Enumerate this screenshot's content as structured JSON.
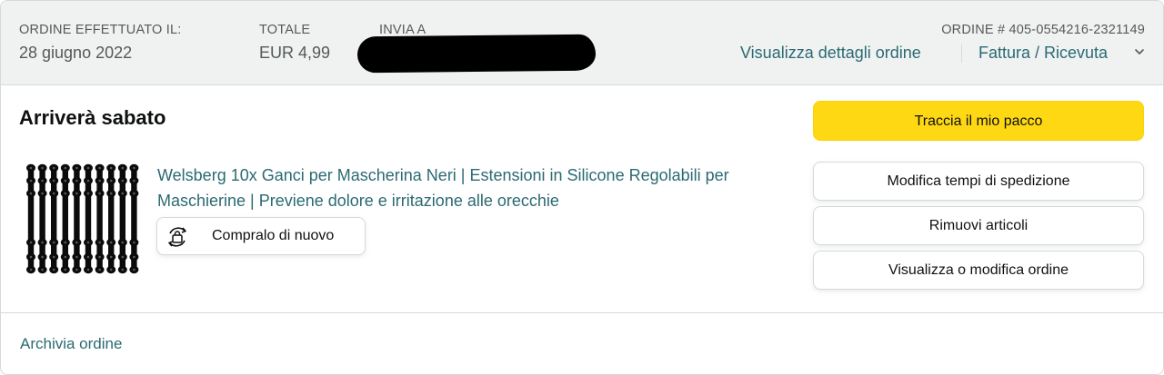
{
  "header": {
    "order_placed_label": "ORDINE EFFETTUATO IL:",
    "order_placed_value": "28 giugno 2022",
    "total_label": "TOTALE",
    "total_value": "EUR 4,99",
    "ship_to_label": "INVIA A",
    "order_number": "ORDINE # 405-0554216-2321149",
    "view_details_link": "Visualizza dettagli ordine",
    "invoice_link": "Fattura / Ricevuta"
  },
  "shipment": {
    "status": "Arriverà sabato"
  },
  "item": {
    "title": "Welsberg 10x Ganci per Mascherina Neri | Estensioni in Silicone Regolabili per Maschierine | Previene dolore e irritazione alle orecchie",
    "buy_again_label": "Compralo di nuovo",
    "thumbnail_icon": "mask-hooks-product-image"
  },
  "actions": {
    "track": "Traccia il mio pacco",
    "change_delivery": "Modifica tempi di spedizione",
    "remove_items": "Rimuovi articoli",
    "view_edit_order": "Visualizza o modifica ordine"
  },
  "footer": {
    "archive_link": "Archivia ordine"
  },
  "colors": {
    "link": "#2b6a72",
    "primary_button": "#ffd814",
    "header_bg": "#f0f2f2",
    "border": "#d5d9d9"
  }
}
